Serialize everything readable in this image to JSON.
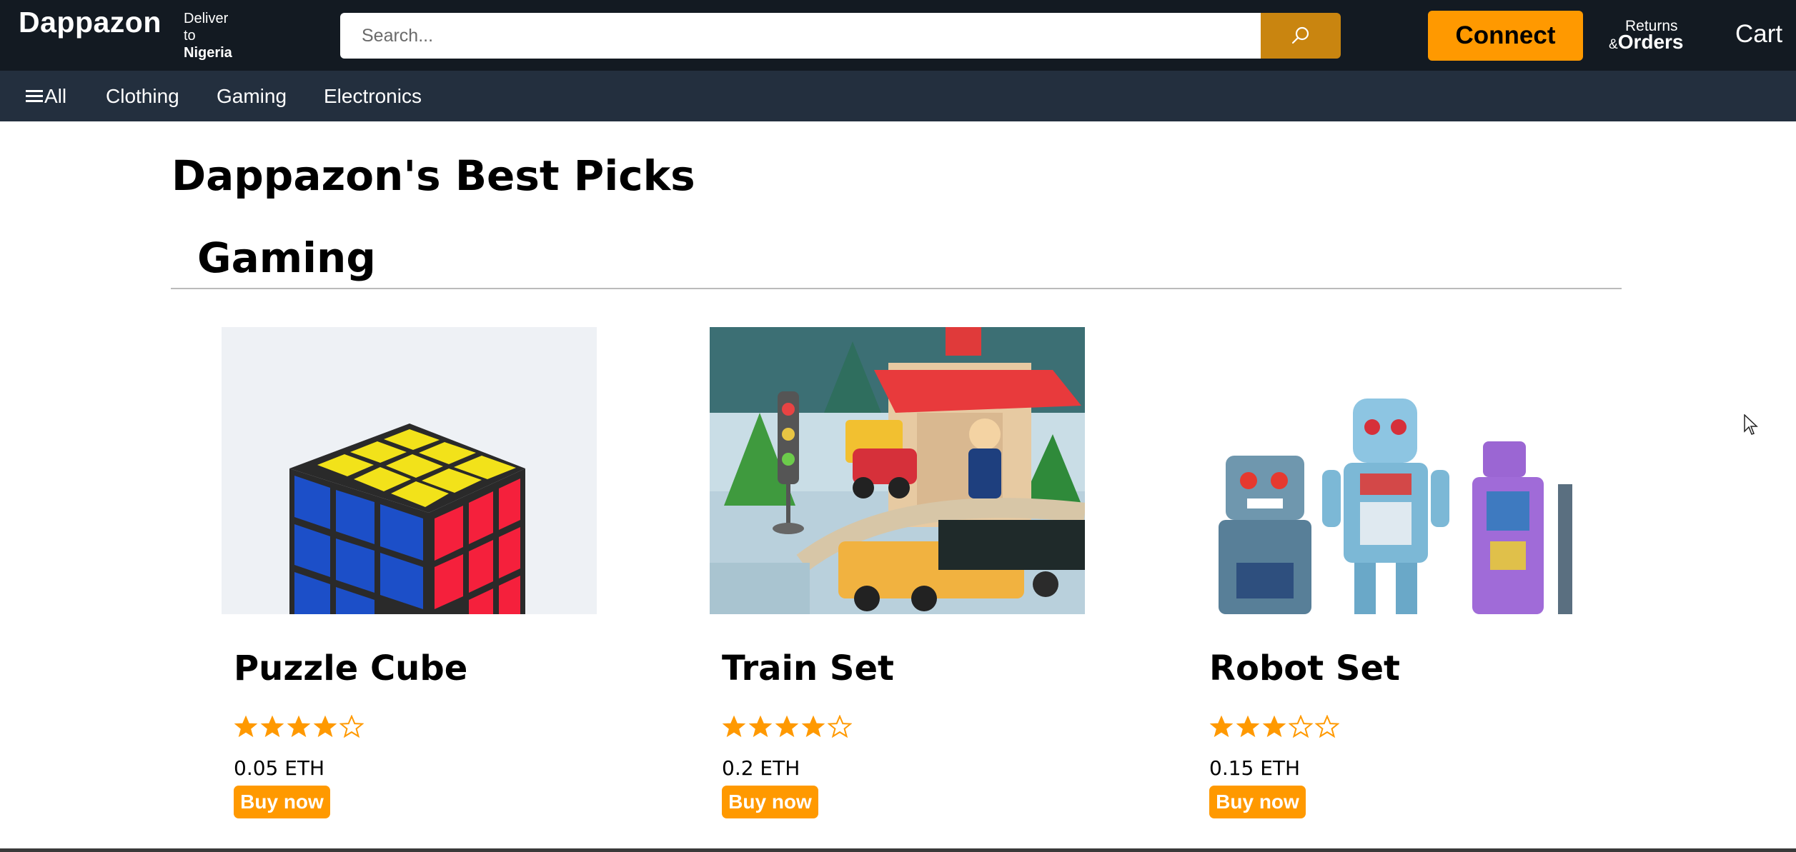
{
  "header": {
    "brand": "Dappazon",
    "deliver_line1": "Deliver",
    "deliver_line2": "to",
    "deliver_location": "Nigeria",
    "search_placeholder": "Search...",
    "connect_label": "Connect",
    "returns_label": "Returns",
    "amp_label": "&",
    "orders_label": "Orders",
    "cart_label": "Cart"
  },
  "subnav": {
    "all_label": "All",
    "items": [
      "Clothing",
      "Gaming",
      "Electronics"
    ]
  },
  "main": {
    "title": "Dappazon's Best Picks",
    "section_title": "Gaming",
    "products": [
      {
        "name": "Puzzle Cube",
        "rating": 4,
        "price": "0.05 ETH",
        "buy_label": "Buy now",
        "image": "rubiks-cube"
      },
      {
        "name": "Train Set",
        "rating": 4,
        "price": "0.2 ETH",
        "buy_label": "Buy now",
        "image": "toy-train-set"
      },
      {
        "name": "Robot Set",
        "rating": 3,
        "price": "0.15 ETH",
        "buy_label": "Buy now",
        "image": "toy-robots"
      }
    ]
  },
  "colors": {
    "topbar": "#131a22",
    "subnav": "#232f3e",
    "accent": "#ff9900",
    "search_button": "#c98510"
  }
}
